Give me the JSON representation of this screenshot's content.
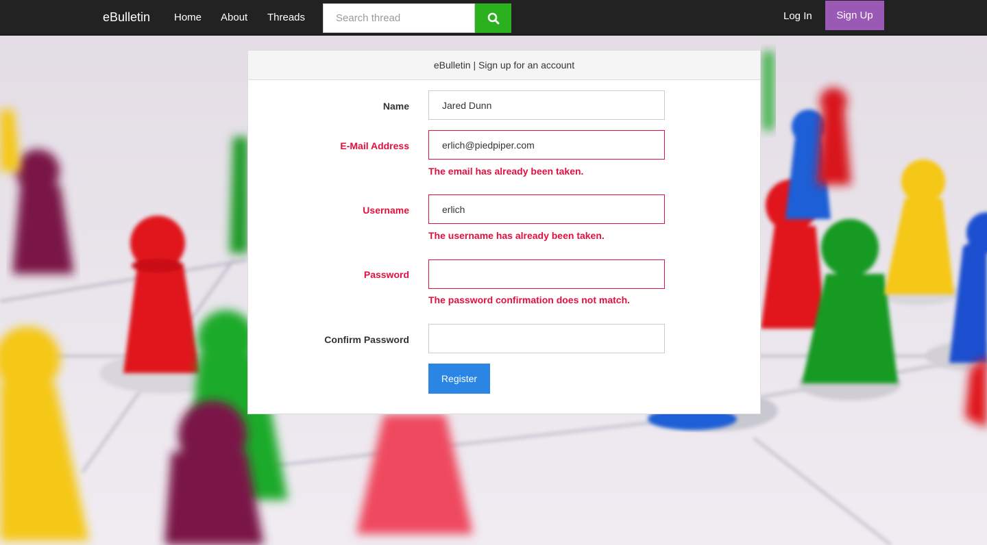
{
  "navbar": {
    "brand": "eBulletin",
    "links": [
      "Home",
      "About",
      "Threads"
    ],
    "search_placeholder": "Search thread",
    "search_icon": "search-icon",
    "login_label": "Log In",
    "signup_label": "Sign Up",
    "colors": {
      "background": "#222222",
      "search_button": "#2ab11d",
      "signup_button": "#9b59b6"
    }
  },
  "card": {
    "header": "eBulletin | Sign up for an account",
    "fields": {
      "name": {
        "label": "Name",
        "value": "Jared Dunn"
      },
      "email": {
        "label": "E-Mail Address",
        "value": "erlich@piedpiper.com",
        "error": "The email has already been taken."
      },
      "username": {
        "label": "Username",
        "value": "erlich",
        "error": "The username has already been taken."
      },
      "password": {
        "label": "Password",
        "value": "",
        "error": "The password confirmation does not match."
      },
      "confirm_password": {
        "label": "Confirm Password",
        "value": ""
      }
    },
    "register_label": "Register",
    "colors": {
      "error": "#e0103e",
      "register_button": "#2a85e5"
    }
  }
}
